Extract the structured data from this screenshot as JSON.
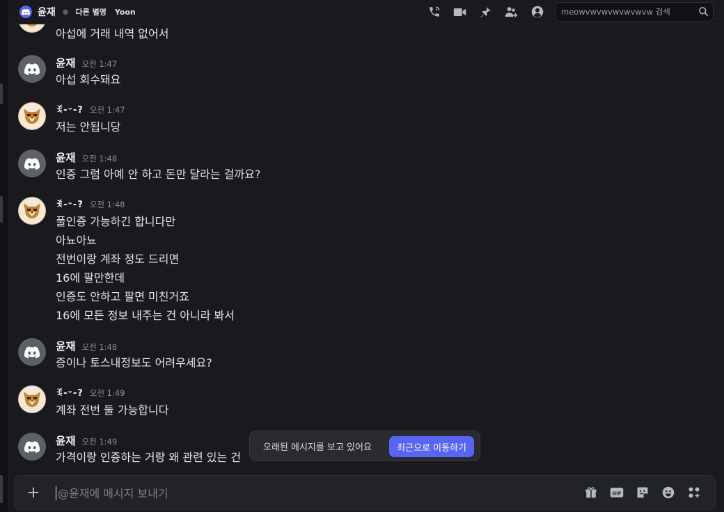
{
  "header": {
    "name": "윤재",
    "alias_label": "다른 별명",
    "alias": "Yoon",
    "icons": [
      "phone-call-icon",
      "video-call-icon",
      "pin-icon",
      "add-friend-icon",
      "profile-icon"
    ]
  },
  "search": {
    "placeholder": "meowvwvwvwvwvwvw 검색"
  },
  "messages": [
    {
      "author": "",
      "time": "",
      "avatar": "cat",
      "lines": [
        "아섭에 거래 내역 없어서"
      ]
    },
    {
      "author": "윤재",
      "time": "오전 1:47",
      "avatar": "discord",
      "lines": [
        "아섭 회수돼요"
      ]
    },
    {
      "author": "ꉂ-ᵕ-?",
      "time": "오전 1:47",
      "avatar": "cat",
      "lines": [
        "저는 안됩니당"
      ]
    },
    {
      "author": "윤재",
      "time": "오전 1:48",
      "avatar": "discord",
      "lines": [
        "인증 그럼 아예 안 하고 돈만 달라는 걸까요?"
      ]
    },
    {
      "author": "ꉂ-ᵕ-?",
      "time": "오전 1:48",
      "avatar": "cat",
      "lines": [
        "풀인증 가능하긴 합니다만",
        "아뇨아뇨",
        "전번이랑 계좌 정도 드리면",
        "16에 팔만한데",
        "인증도 안하고 팔면 미친거죠",
        "16에 모든 정보 내주는 건 아니라 봐서"
      ]
    },
    {
      "author": "윤재",
      "time": "오전 1:48",
      "avatar": "discord",
      "lines": [
        "증이나 토스내정보도 어려우세요?"
      ]
    },
    {
      "author": "ꉂ-ᵕ-?",
      "time": "오전 1:49",
      "avatar": "cat",
      "lines": [
        "계좌 전번 둘 가능합니다"
      ]
    },
    {
      "author": "윤재",
      "time": "오전 1:49",
      "avatar": "discord",
      "lines": [
        "가격이랑 인증하는 거랑 왜 관련 있는 건"
      ]
    }
  ],
  "toast": {
    "text": "오래된 메시지를 보고 있어요",
    "button": "최근으로 이동하기"
  },
  "composer": {
    "placeholder": "@윤재에 메시지 보내기",
    "tools": [
      "gift-icon",
      "gif-icon",
      "sticker-icon",
      "emoji-icon",
      "apps-icon"
    ]
  },
  "colors": {
    "accent": "#5865f2",
    "background": "#1a1a1e",
    "composer": "#222327"
  }
}
